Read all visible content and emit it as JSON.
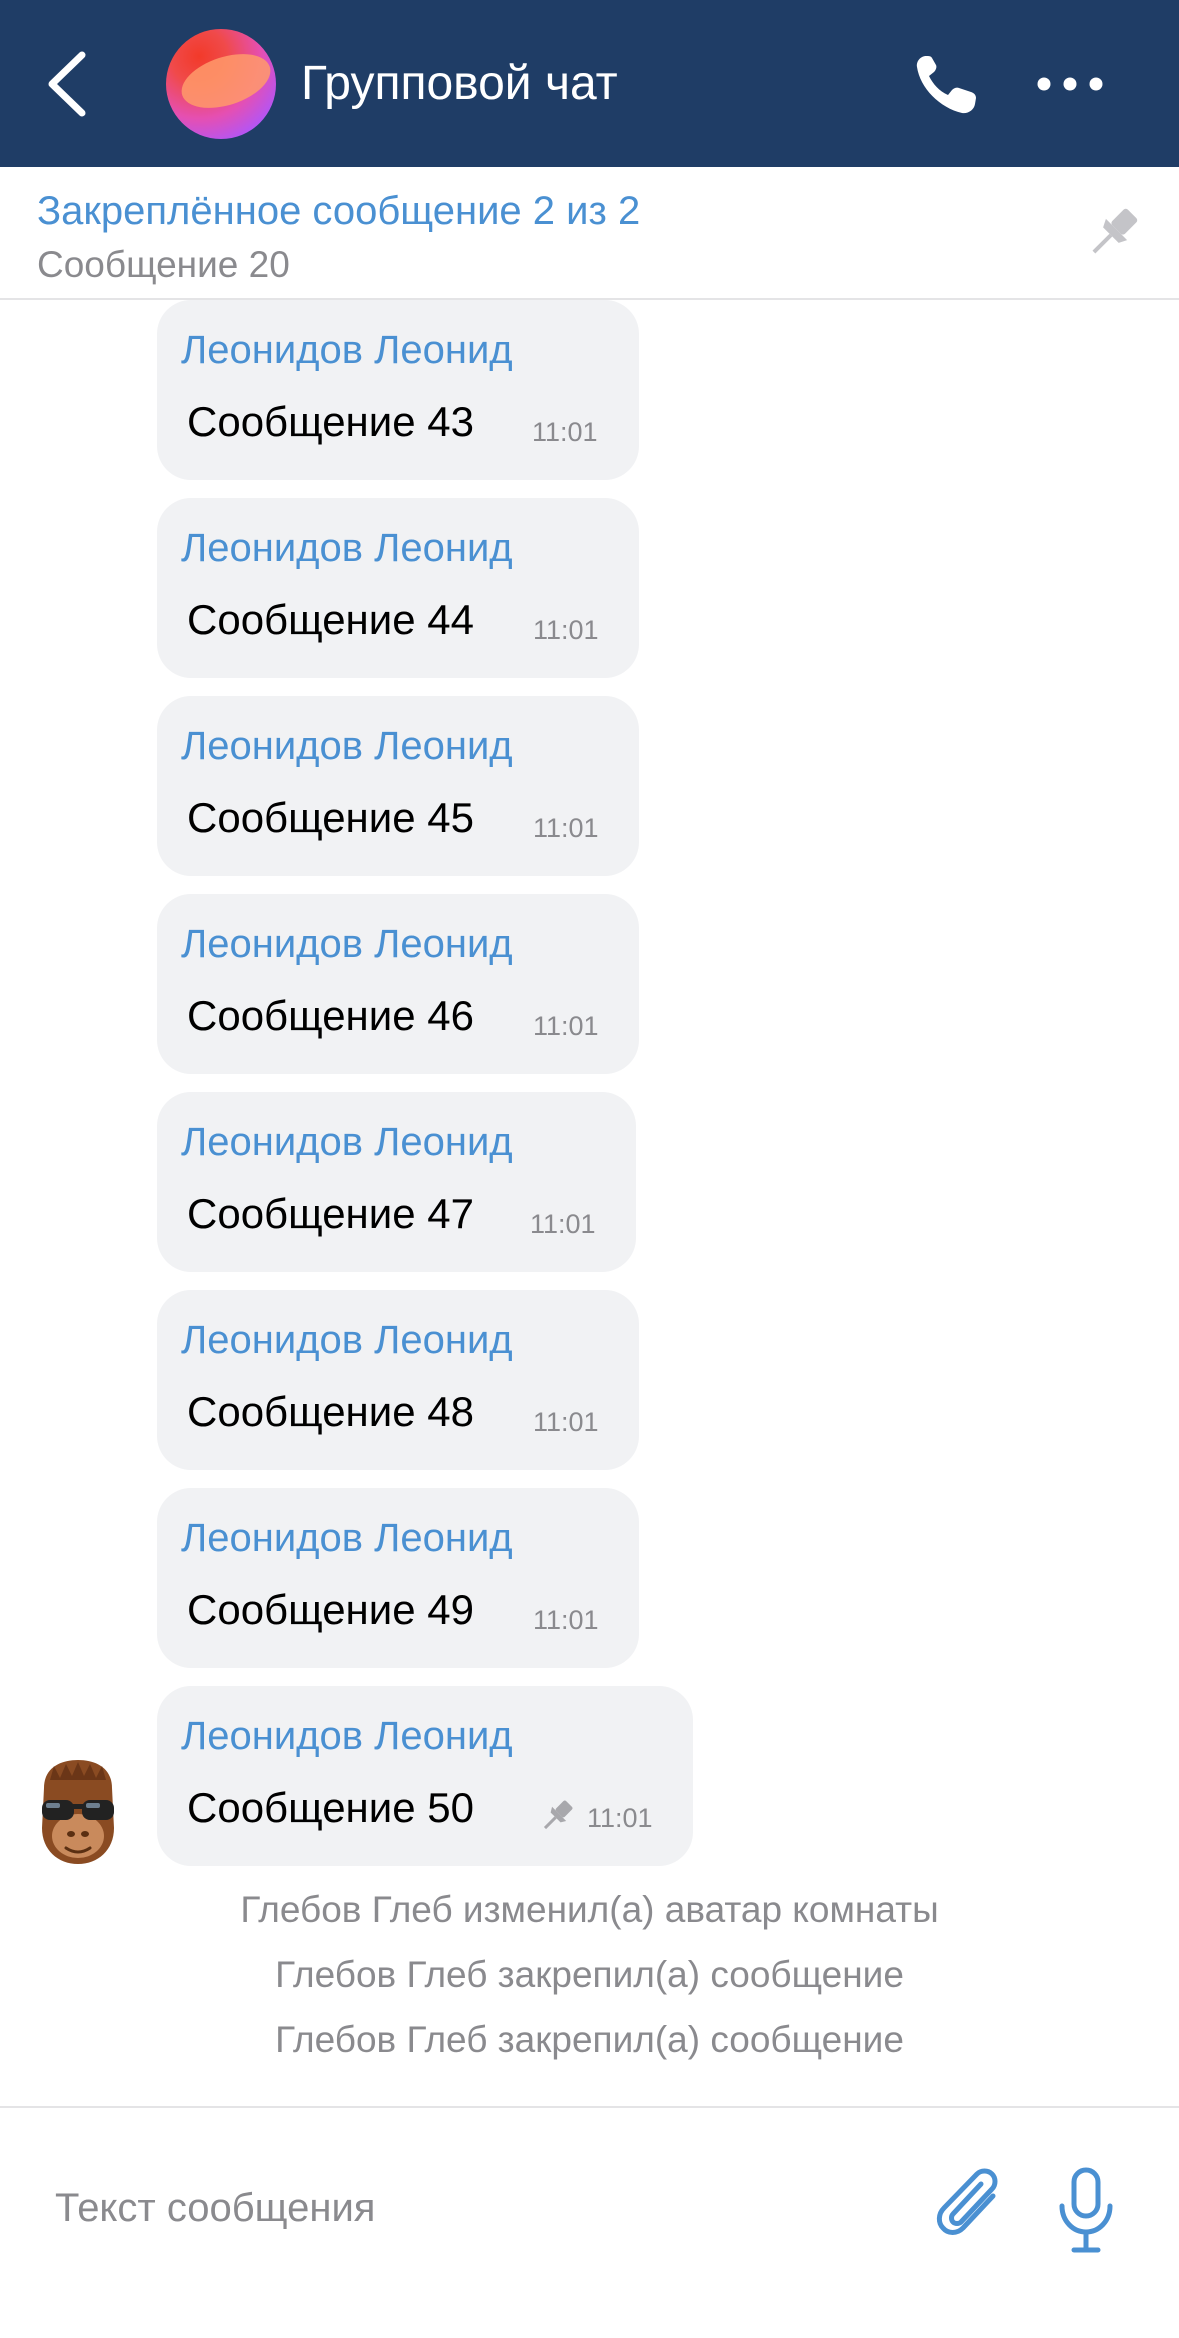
{
  "header": {
    "title": "Групповой чат",
    "back_icon": "chevron-left-icon",
    "call_icon": "phone-icon",
    "more_icon": "more-horizontal-icon",
    "background_color": "#1f3d66"
  },
  "pinned": {
    "title": "Закреплённое сообщение 2 из 2",
    "text": "Сообщение 20",
    "icon": "pin-icon"
  },
  "messages": [
    {
      "author": "Леонидов Леонид",
      "text": "Сообщение 43",
      "time": "11:01"
    },
    {
      "author": "Леонидов Леонид",
      "text": "Сообщение 44",
      "time": "11:01"
    },
    {
      "author": "Леонидов Леонид",
      "text": "Сообщение 45",
      "time": "11:01"
    },
    {
      "author": "Леонидов Леонид",
      "text": "Сообщение 46",
      "time": "11:01"
    },
    {
      "author": "Леонидов Леонид",
      "text": "Сообщение 47",
      "time": "11:01"
    },
    {
      "author": "Леонидов Леонид",
      "text": "Сообщение 48",
      "time": "11:01"
    },
    {
      "author": "Леонидов Леонид",
      "text": "Сообщение 49",
      "time": "11:01"
    },
    {
      "author": "Леонидов Леонид",
      "text": "Сообщение 50",
      "time": "11:01",
      "pinned": true
    }
  ],
  "system_messages": [
    "Глебов Глеб изменил(а) аватар комнаты",
    "Глебов Глеб закрепил(а) сообщение",
    "Глебов Глеб закрепил(а) сообщение"
  ],
  "composer": {
    "placeholder": "Текст сообщения",
    "attach_icon": "paperclip-icon",
    "mic_icon": "microphone-icon"
  },
  "colors": {
    "accent": "#4a90d2",
    "bubble": "#f1f2f4",
    "muted_text": "#8a8a8e"
  }
}
